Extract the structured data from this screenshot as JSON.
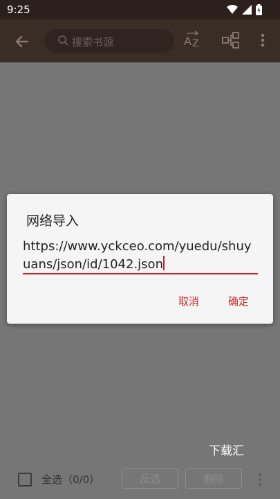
{
  "status_bar": {
    "time": "9:25"
  },
  "toolbar": {
    "search_placeholder": "搜索书源"
  },
  "dialog": {
    "title": "网络导入",
    "url_value": "https://www.yckceo.com/yuedu/shuyuans/json/id/1042.json",
    "cancel_label": "取消",
    "ok_label": "确定"
  },
  "download_label": "下载汇",
  "bottom_bar": {
    "select_all_label": "全选（0/0）",
    "invert_label": "反选",
    "delete_label": "删除"
  },
  "colors": {
    "accent": "#c62828",
    "toolbar": "#3a2d26",
    "scrim": "#767676"
  }
}
